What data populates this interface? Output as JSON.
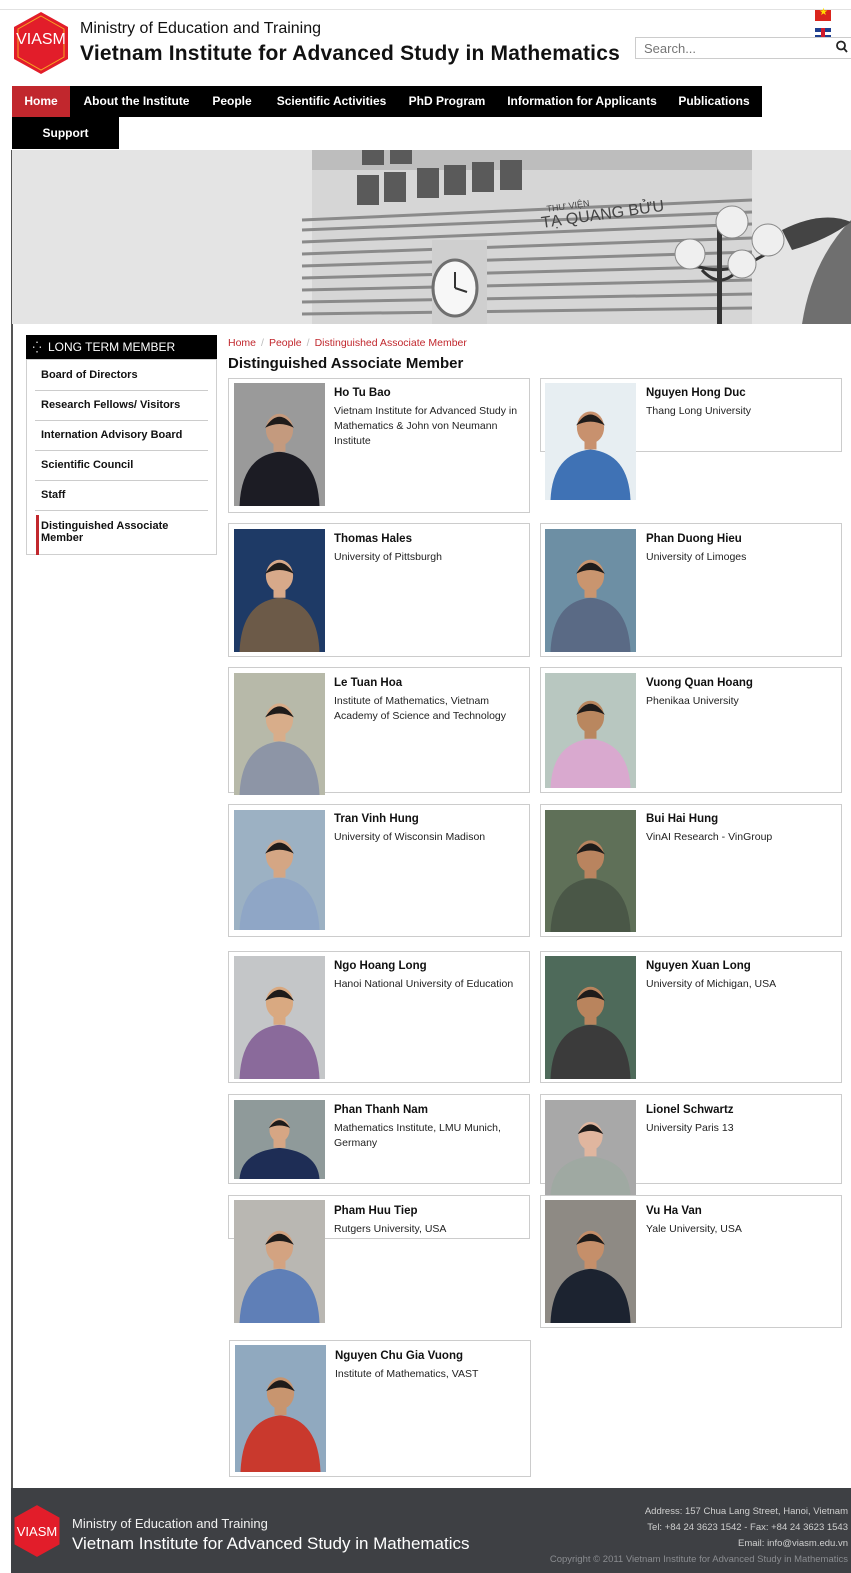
{
  "header": {
    "logo_text": "VIASM",
    "ministry": "Ministry of Education and Training",
    "institute": "Vietnam Institute for Advanced Study in Mathematics",
    "search_placeholder": "Search..."
  },
  "nav": {
    "items": [
      "Home",
      "About the Institute",
      "People",
      "Scientific Activities",
      "PhD Program",
      "Information for Applicants",
      "Publications",
      "Support"
    ],
    "active": "Home"
  },
  "banner": {
    "sign": "TẠ QUANG BỬU",
    "sign_small": "THƯ VIỆN"
  },
  "sidebar": {
    "title": "LONG TERM MEMBER",
    "items": [
      {
        "label": "Board of Directors"
      },
      {
        "label": "Research Fellows/ Visitors"
      },
      {
        "label": "Internation Advisory Board"
      },
      {
        "label": "Scientific Council"
      },
      {
        "label": "Staff"
      },
      {
        "label": "Distinguished Associate Member"
      }
    ]
  },
  "breadcrumb": [
    "Home",
    "People",
    "Distinguished Associate Member"
  ],
  "page_title": "Distinguished Associate Member",
  "members": [
    {
      "name": "Ho Tu Bao",
      "affiliation": "Vietnam Institute for Advanced Study in Mathematics & John von Neumann Institute",
      "bg": "#9a9a9a",
      "shirt": "#1c1c24",
      "skin": "#c49a7e"
    },
    {
      "name": "Nguyen Hong Duc",
      "affiliation": "Thang Long University",
      "bg": "#e7eef2",
      "shirt": "#3f72b5",
      "skin": "#c8916e"
    },
    {
      "name": "Thomas Hales",
      "affiliation": "University of Pittsburgh",
      "bg": "#1e3a66",
      "shirt": "#6c5a48",
      "skin": "#d7a98a"
    },
    {
      "name": "Phan Duong Hieu",
      "affiliation": "University of Limoges",
      "bg": "#6d8fa4",
      "shirt": "#5a6a85",
      "skin": "#c9956f"
    },
    {
      "name": "Le Tuan Hoa",
      "affiliation": "Institute of Mathematics, Vietnam Academy of Science and Technology",
      "bg": "#b7b9a9",
      "shirt": "#8d95a6",
      "skin": "#d8ad8a"
    },
    {
      "name": "Vuong Quan Hoang",
      "affiliation": "Phenikaa University",
      "bg": "#b8c7c0",
      "shirt": "#d9a9cf",
      "skin": "#b9875f"
    },
    {
      "name": "Tran Vinh Hung",
      "affiliation": "University of Wisconsin Madison",
      "bg": "#9cb1c3",
      "shirt": "#8fa6c6",
      "skin": "#d4a684"
    },
    {
      "name": "Bui Hai Hung",
      "affiliation": "VinAI Research - VinGroup",
      "bg": "#5f7058",
      "shirt": "#4a5747",
      "skin": "#b9845f"
    },
    {
      "name": "Ngo Hoang Long",
      "affiliation": "Hanoi National University of Education",
      "bg": "#c4c6c8",
      "shirt": "#8a6a9b",
      "skin": "#d9a981"
    },
    {
      "name": "Nguyen Xuan Long",
      "affiliation": "University of Michigan, USA",
      "bg": "#4e6a5a",
      "shirt": "#3b3b3b",
      "skin": "#b9845d"
    },
    {
      "name": "Phan Thanh Nam",
      "affiliation": "Mathematics Institute, LMU Munich, Germany",
      "bg": "#8f9a9a",
      "shirt": "#1e2d55",
      "skin": "#d6a684"
    },
    {
      "name": "Lionel Schwartz",
      "affiliation": "University Paris 13",
      "bg": "#a8a8a8",
      "shirt": "#9fa9a2",
      "skin": "#e0b69f"
    },
    {
      "name": "Pham Huu Tiep",
      "affiliation": "Rutgers University, USA",
      "bg": "#b9b7b2",
      "shirt": "#5f7fb7",
      "skin": "#d3a381"
    },
    {
      "name": "Vu Ha Van",
      "affiliation": "Yale University, USA",
      "bg": "#8e8a84",
      "shirt": "#1c2330",
      "skin": "#c58f6a"
    },
    {
      "name": "Nguyen Chu Gia Vuong",
      "affiliation": "Institute of Mathematics, VAST",
      "bg": "#90a9bf",
      "shirt": "#c9392d",
      "skin": "#c8956f"
    }
  ],
  "footer": {
    "logo_text": "VIASM",
    "ministry": "Ministry of Education and Training",
    "institute": "Vietnam Institute for Advanced Study in Mathematics",
    "address": "Address: 157 Chua Lang Street, Hanoi, Vietnam",
    "tel": "Tel: +84 24 3623 1542 - Fax: +84 24 3623 1543",
    "email": "Email: info@viasm.edu.vn",
    "copyright": "Copyright © 2011 Vietnam Institute for Advanced Study in Mathematics"
  },
  "colors": {
    "accent": "#c1272d",
    "nav_bg": "#000000",
    "footer_bg": "#3e4044",
    "logo_red": "#e21d2a"
  }
}
